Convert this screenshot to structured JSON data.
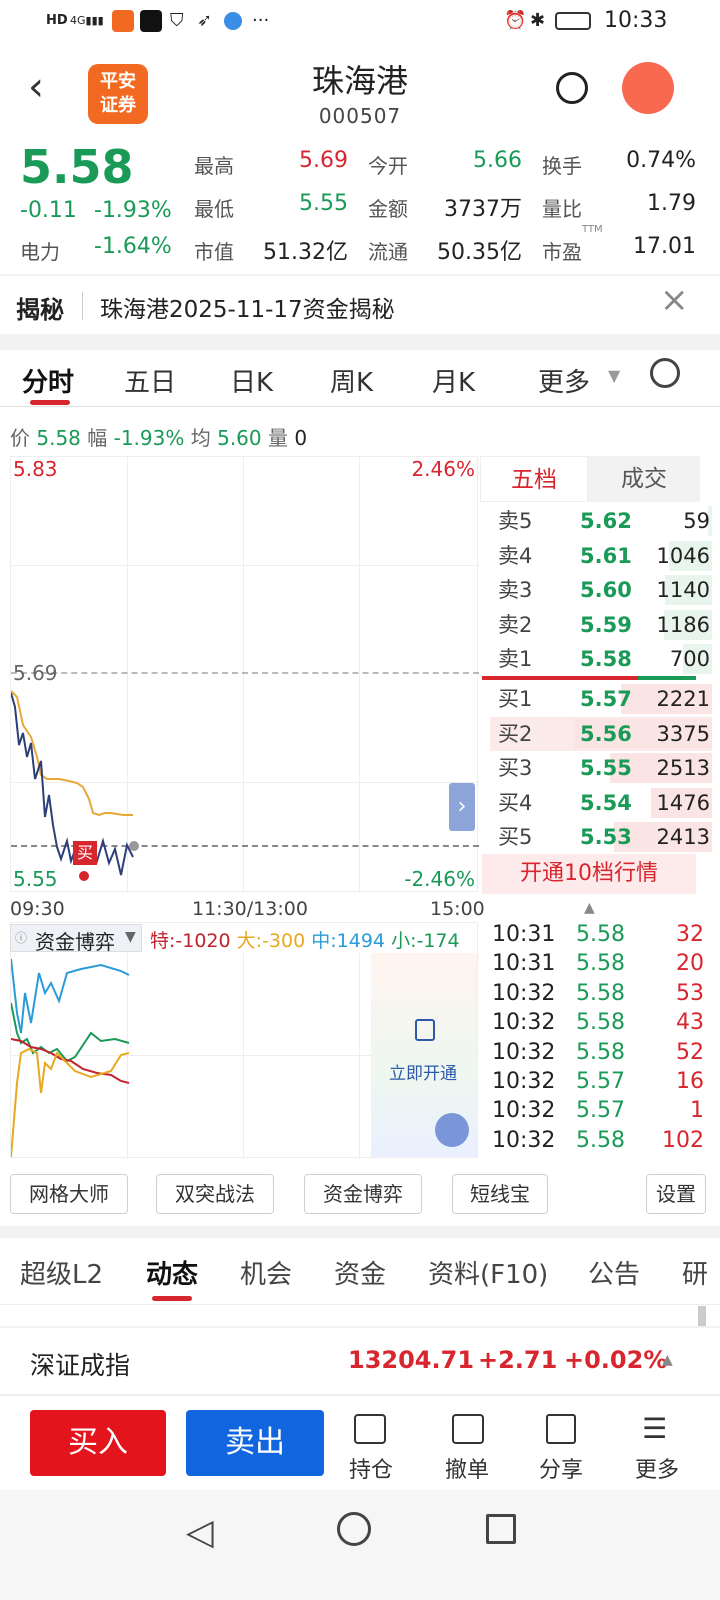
{
  "status_bar": {
    "left_icons": [
      "HD",
      "4G",
      "app-icon-1",
      "app-icon-2",
      "shield-icon",
      "send-icon",
      "globe-icon",
      "..."
    ],
    "time": "10:33"
  },
  "header": {
    "logo_line1": "平安",
    "logo_line2": "证券",
    "title": "珠海港",
    "code": "000507"
  },
  "quote": {
    "price": "5.58",
    "change": "-0.11",
    "change_pct": "-1.93%",
    "power_label": "电力",
    "power_val": "-1.64%",
    "high_label": "最高",
    "high_val": "5.69",
    "open_label": "今开",
    "open_val": "5.66",
    "turnover_label": "换手",
    "turnover_val": "0.74%",
    "low_label": "最低",
    "low_val": "5.55",
    "amount_label": "金额",
    "amount_val": "3737万",
    "vr_label": "量比",
    "vr_val": "1.79",
    "mcap_label": "市值",
    "mcap_val": "51.32亿",
    "float_label": "流通",
    "float_val": "50.35亿",
    "pe_label": "市盈",
    "pe_sup": "TTM",
    "pe_val": "17.01"
  },
  "reveal": {
    "label": "揭秘",
    "text": "珠海港2025-11-17资金揭秘"
  },
  "kline_tabs": [
    "分时",
    "五日",
    "日K",
    "周K",
    "月K",
    "更多"
  ],
  "info_line": {
    "price_label": "价",
    "price": "5.58",
    "amp_label": "幅",
    "amp": "-1.93%",
    "avg_label": "均",
    "avg": "5.60",
    "vol_label": "量",
    "vol": "0"
  },
  "chart": {
    "top_price": "5.83",
    "top_pct": "2.46%",
    "mid_price": "5.69",
    "bottom_price": "5.55",
    "bottom_pct": "-2.46%",
    "buy_marker": "买",
    "time_start": "09:30",
    "time_mid": "11:30/13:00",
    "time_end": "15:00"
  },
  "orderbook": {
    "tab_active": "五档",
    "tab_other": "成交",
    "sell": [
      {
        "label": "卖5",
        "price": "5.62",
        "vol": "59",
        "ratio": 0.03
      },
      {
        "label": "卖4",
        "price": "5.61",
        "vol": "1046",
        "ratio": 0.31
      },
      {
        "label": "卖3",
        "price": "5.60",
        "vol": "1140",
        "ratio": 0.34
      },
      {
        "label": "卖2",
        "price": "5.59",
        "vol": "1186",
        "ratio": 0.35
      },
      {
        "label": "卖1",
        "price": "5.58",
        "vol": "700",
        "ratio": 0.21
      }
    ],
    "buy": [
      {
        "label": "买1",
        "price": "5.57",
        "vol": "2221",
        "ratio": 0.66
      },
      {
        "label": "买2",
        "price": "5.56",
        "vol": "3375",
        "ratio": 1.0
      },
      {
        "label": "买3",
        "price": "5.55",
        "vol": "2513",
        "ratio": 0.74
      },
      {
        "label": "买4",
        "price": "5.54",
        "vol": "1476",
        "ratio": 0.44
      },
      {
        "label": "买5",
        "price": "5.53",
        "vol": "2413",
        "ratio": 0.71
      }
    ],
    "upgrade": "开通10档行情"
  },
  "ticks": [
    {
      "time": "10:31",
      "price": "5.58",
      "vol": "32"
    },
    {
      "time": "10:31",
      "price": "5.58",
      "vol": "20"
    },
    {
      "time": "10:32",
      "price": "5.58",
      "vol": "53"
    },
    {
      "time": "10:32",
      "price": "5.58",
      "vol": "43"
    },
    {
      "time": "10:32",
      "price": "5.58",
      "vol": "52"
    },
    {
      "time": "10:32",
      "price": "5.57",
      "vol": "16"
    },
    {
      "time": "10:32",
      "price": "5.57",
      "vol": "1"
    },
    {
      "time": "10:32",
      "price": "5.58",
      "vol": "102"
    }
  ],
  "capital": {
    "selector": "资金博弈",
    "special": "特:-1020",
    "large": "大:-300",
    "medium": "中:1494",
    "small": "小:-174",
    "unlock": "立即开通"
  },
  "tools": [
    "网格大师",
    "双突战法",
    "资金博弈",
    "短线宝",
    "设置"
  ],
  "bottom_tabs": [
    "超级L2",
    "动态",
    "机会",
    "资金",
    "资料(F10)",
    "公告",
    "研"
  ],
  "index_bar": {
    "name": "深证成指",
    "value": "13204.71",
    "change": "+2.71",
    "pct": "+0.02%"
  },
  "actions": {
    "buy": "买入",
    "sell": "卖出",
    "position": "持仓",
    "cancel": "撤单",
    "share": "分享",
    "more": "更多"
  },
  "colors": {
    "up": "#d8262e",
    "down": "#1a9a57",
    "accent_orange": "#f26a21",
    "sell_blue": "#1166e0"
  }
}
